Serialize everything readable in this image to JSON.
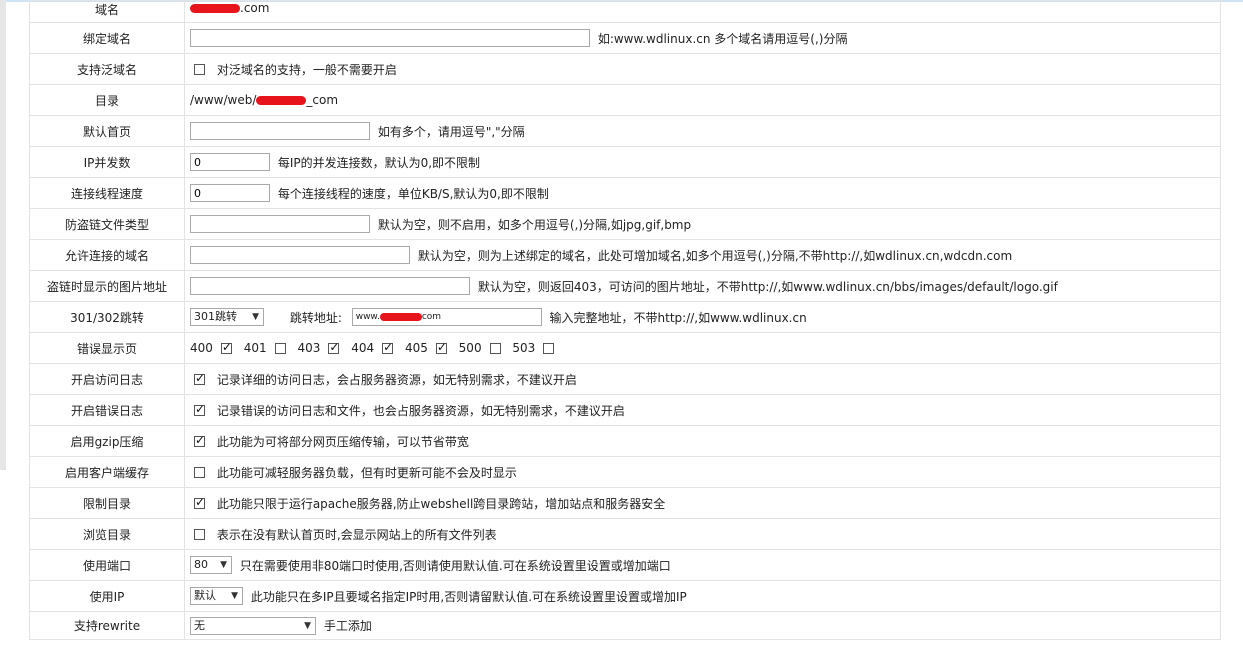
{
  "rows": {
    "domain": {
      "label": "域名",
      "suffix": ".com"
    },
    "bind_domain": {
      "label": "绑定域名",
      "value": "",
      "hint": "如:www.wdlinux.cn 多个域名请用逗号(,)分隔"
    },
    "wildcard": {
      "label": "支持泛域名",
      "checked": false,
      "text": "对泛域名的支持，一般不需要开启"
    },
    "directory": {
      "label": "目录",
      "prefix": "/www/web/",
      "suffix": "_com"
    },
    "default_index": {
      "label": "默认首页",
      "value": "",
      "hint": "如有多个，请用逗号\",\"分隔"
    },
    "ip_concurrency": {
      "label": "IP并发数",
      "value": "0",
      "hint": "每IP的并发连接数，默认为0,即不限制"
    },
    "thread_speed": {
      "label": "连接线程速度",
      "value": "0",
      "hint": "每个连接线程的速度，单位KB/S,默认为0,即不限制"
    },
    "hotlink_types": {
      "label": "防盗链文件类型",
      "value": "",
      "hint": "默认为空，则不启用，如多个用逗号(,)分隔,如jpg,gif,bmp"
    },
    "allowed_domains": {
      "label": "允许连接的域名",
      "value": "",
      "hint": "默认为空，则为上述绑定的域名，此处可增加域名,如多个用逗号(,)分隔,不带http://,如wdlinux.cn,wdcdn.com"
    },
    "hotlink_image": {
      "label": "盗链时显示的图片地址",
      "value": "",
      "hint": "默认为空，则返回403，可访问的图片地址，不带http://,如www.wdlinux.cn/bbs/images/default/logo.gif"
    },
    "redirect": {
      "label": "301/302跳转",
      "select": "301跳转",
      "addr_label": "跳转地址:",
      "addr_prefix": "www.",
      "addr_suffix": "com",
      "hint": "输入完整地址，不带http://,如www.wdlinux.cn"
    },
    "error_pages": {
      "label": "错误显示页",
      "codes": [
        {
          "code": "400",
          "checked": true
        },
        {
          "code": "401",
          "checked": false
        },
        {
          "code": "403",
          "checked": true
        },
        {
          "code": "404",
          "checked": true
        },
        {
          "code": "405",
          "checked": true
        },
        {
          "code": "500",
          "checked": false
        },
        {
          "code": "503",
          "checked": false
        }
      ]
    },
    "access_log": {
      "label": "开启访问日志",
      "checked": true,
      "text": "记录详细的访问日志，会占服务器资源，如无特别需求，不建议开启"
    },
    "error_log": {
      "label": "开启错误日志",
      "checked": true,
      "text": "记录错误的访问日志和文件，也会占服务器资源，如无特别需求，不建议开启"
    },
    "gzip": {
      "label": "启用gzip压缩",
      "checked": true,
      "text": "此功能为可将部分网页压缩传输，可以节省带宽"
    },
    "client_cache": {
      "label": "启用客户端缓存",
      "checked": false,
      "text": "此功能可减轻服务器负载，但有时更新可能不会及时显示"
    },
    "restrict_dir": {
      "label": "限制目录",
      "checked": true,
      "text": "此功能只限于运行apache服务器,防止webshell跨目录跨站，增加站点和服务器安全"
    },
    "browse_dir": {
      "label": "浏览目录",
      "checked": false,
      "text": "表示在没有默认首页时,会显示网站上的所有文件列表"
    },
    "port": {
      "label": "使用端口",
      "select": "80",
      "hint": "只在需要使用非80端口时使用,否则请使用默认值.可在系统设置里设置或增加端口"
    },
    "ip": {
      "label": "使用IP",
      "select": "默认",
      "hint": "此功能只在多IP且要域名指定IP时用,否则请留默认值.可在系统设置里设置或增加IP"
    },
    "rewrite": {
      "label": "支持rewrite",
      "select": "无",
      "hint": "手工添加"
    }
  },
  "icons": {
    "dropdown": "chevron-down-icon",
    "check": "checkmark-icon"
  },
  "colors": {
    "redaction": "#e8141b",
    "border": "#e3e3e3"
  }
}
